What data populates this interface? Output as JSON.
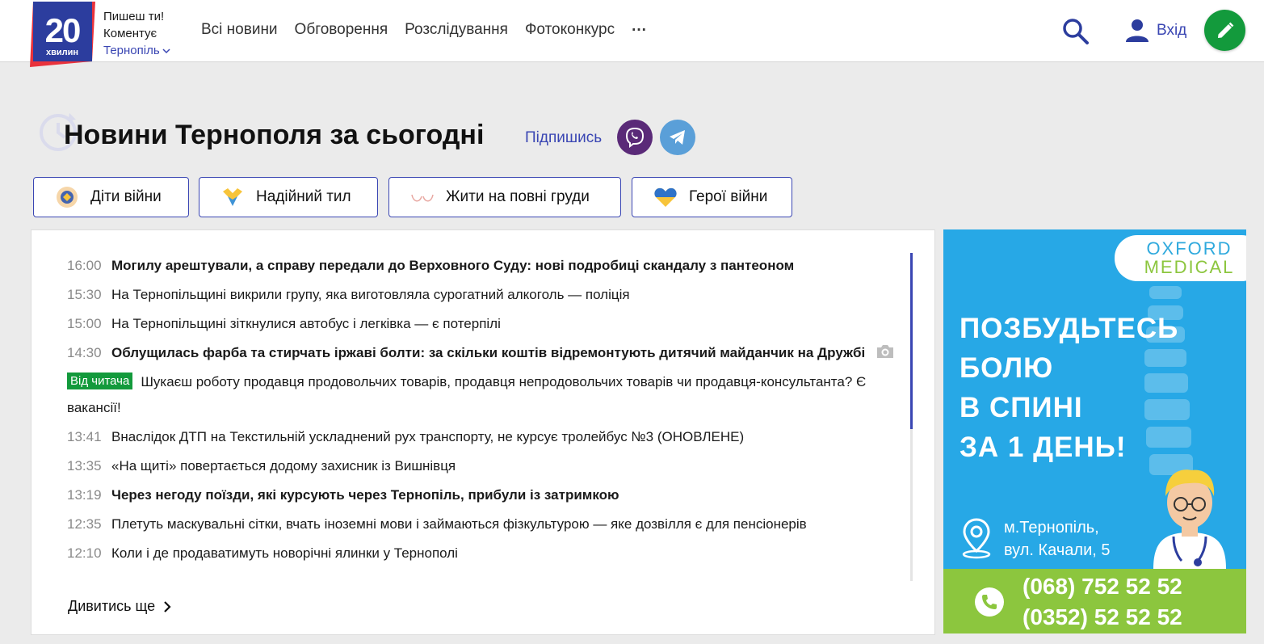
{
  "header": {
    "logo": {
      "number": "20",
      "word": "хвилин"
    },
    "slogan": {
      "line1": "Пишеш ти!",
      "line2": "Коментує",
      "city": "Тернопіль"
    },
    "nav": [
      {
        "label": "Всі новини"
      },
      {
        "label": "Обговорення"
      },
      {
        "label": "Розслідування"
      },
      {
        "label": "Фотоконкурс"
      },
      {
        "label": "..."
      }
    ],
    "login_label": "Вхід"
  },
  "page": {
    "title": "Новини Тернополя за сьогодні",
    "subscribe_label": "Підпишись"
  },
  "tags": [
    {
      "label": "Діти війни",
      "icon": "children-of-war-icon"
    },
    {
      "label": "Надійний тил",
      "icon": "reliable-rear-icon"
    },
    {
      "label": "Жити на повні груди",
      "icon": "breast-icon"
    },
    {
      "label": "Герої війни",
      "icon": "ukraine-heart-icon"
    }
  ],
  "news": [
    {
      "time": "16:00",
      "headline": "Могилу арештували, а справу передали до Верховного Суду: нові подробиці скандалу з пантеоном",
      "bold": true
    },
    {
      "time": "15:30",
      "headline": "На Тернопільщині викрили групу, яка виготовляла сурогатний алкоголь — поліція",
      "bold": false
    },
    {
      "time": "15:00",
      "headline": "На Тернопільщині зіткнулися автобус і легківка — є потерпілі",
      "bold": false
    },
    {
      "time": "14:30",
      "headline": "Облущилась фарба та стирчать іржаві болти: за скільки коштів відремонтують дитячий майданчик на Дружбі",
      "bold": true,
      "camera": true
    },
    {
      "badge": "Від читача",
      "headline": "Шукаєш роботу продавця продовольчих товарів, продавця непродовольчих товарів чи продавця-консультанта? Є вакансії!",
      "bold": false
    },
    {
      "time": "13:41",
      "headline": "Внаслідок ДТП на Текстильній ускладнений рух транспорту, не курсує тролейбус №3 (ОНОВЛЕНЕ)",
      "bold": false
    },
    {
      "time": "13:35",
      "headline": "«На щиті» повертається додому захисник із Вишнівця",
      "bold": false
    },
    {
      "time": "13:19",
      "headline": "Через негоду поїзди, які курсують через Тернопіль, прибули із затримкою",
      "bold": true
    },
    {
      "time": "12:35",
      "headline": "Плетуть маскувальні сітки, вчать іноземні мови і займаються фізкультурою — яке дозвілля є для пенсіонерів",
      "bold": false
    },
    {
      "time": "12:10",
      "headline": "Коли і де продаватимуть новорічні ялинки у Тернополі",
      "bold": false
    }
  ],
  "see_more_label": "Дивитись ще",
  "ad": {
    "brand_line1": "OXFORD",
    "brand_line2": "MEDICAL",
    "headline_lines": [
      "ПОЗБУДЬТЕСЬ",
      "БОЛЮ",
      "В СПИНІ",
      "ЗА 1 ДЕНЬ!"
    ],
    "address_line1": "м.Тернопіль,",
    "address_line2": "вул. Качали, 5",
    "phone1": "(068) 752 52 52",
    "phone2": "(0352) 52 52 52"
  },
  "colors": {
    "accent": "#3a46b3",
    "green": "#139a3c",
    "ad_blue": "#27a8e6",
    "ad_green": "#8cc63e",
    "viber": "#5a2a78",
    "telegram": "#5a9fd8"
  }
}
